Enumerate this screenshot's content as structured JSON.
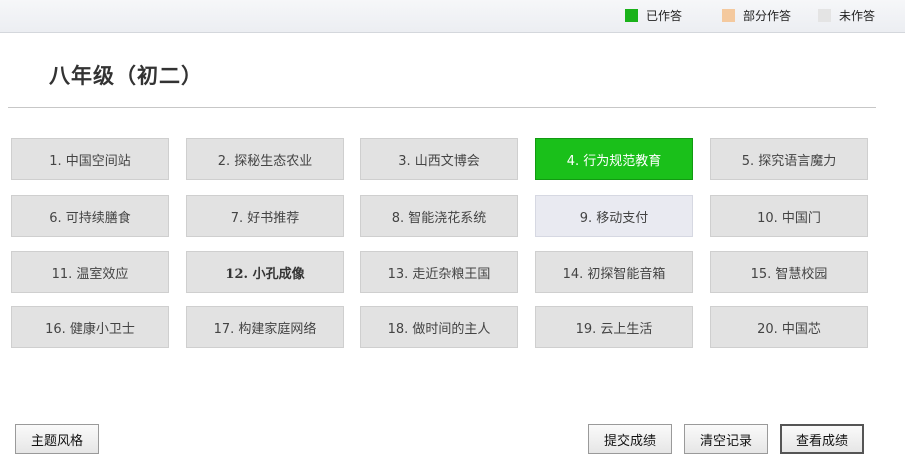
{
  "legend": {
    "items": [
      {
        "label": "已作答",
        "color": "#1ab21a"
      },
      {
        "label": "部分作答",
        "color": "#f4c99e"
      },
      {
        "label": "未作答",
        "color": "#e4e4e4"
      }
    ]
  },
  "title": "八年级（初二）",
  "tiles": [
    {
      "label": "1. 中国空间站",
      "state": "unanswered"
    },
    {
      "label": "2. 探秘生态农业",
      "state": "unanswered"
    },
    {
      "label": "3. 山西文博会",
      "state": "unanswered"
    },
    {
      "label": "4. 行为规范教育",
      "state": "answered"
    },
    {
      "label": "5. 探究语言魔力",
      "state": "unanswered"
    },
    {
      "label": "6. 可持续膳食",
      "state": "unanswered"
    },
    {
      "label": "7. 好书推荐",
      "state": "unanswered"
    },
    {
      "label": "8. 智能浇花系统",
      "state": "unanswered"
    },
    {
      "label": "9. 移动支付",
      "state": "highlighted"
    },
    {
      "label": "10. 中国门",
      "state": "unanswered"
    },
    {
      "label": "11. 温室效应",
      "state": "unanswered"
    },
    {
      "label": "12. 小孔成像",
      "state": "selected"
    },
    {
      "label": "13. 走近杂粮王国",
      "state": "unanswered"
    },
    {
      "label": "14. 初探智能音箱",
      "state": "unanswered"
    },
    {
      "label": "15. 智慧校园",
      "state": "unanswered"
    },
    {
      "label": "16. 健康小卫士",
      "state": "unanswered"
    },
    {
      "label": "17. 构建家庭网络",
      "state": "unanswered"
    },
    {
      "label": "18. 做时间的主人",
      "state": "unanswered"
    },
    {
      "label": "19. 云上生活",
      "state": "unanswered"
    },
    {
      "label": "20. 中国芯",
      "state": "unanswered"
    }
  ],
  "buttons": {
    "theme": "主题风格",
    "submit": "提交成绩",
    "clear": "清空记录",
    "view": "查看成绩"
  }
}
